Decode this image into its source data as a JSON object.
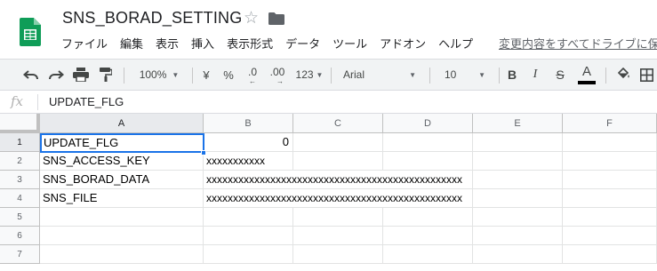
{
  "app": {
    "doc_title": "SNS_BORAD_SETTING",
    "logo_icon": "google-sheets-logo",
    "star_icon": "star-icon",
    "folder_icon": "folder-icon",
    "brand_color": "#0f9d58"
  },
  "menu": {
    "items": [
      "ファイル",
      "編集",
      "表示",
      "挿入",
      "表示形式",
      "データ",
      "ツール",
      "アドオン",
      "ヘルプ"
    ],
    "save_status": "変更内容をすべてドライブに保"
  },
  "toolbar": {
    "undo_icon": "undo-icon",
    "redo_icon": "redo-icon",
    "print_icon": "print-icon",
    "paint_format_icon": "paint-format-icon",
    "zoom": "100%",
    "currency": "¥",
    "percent": "%",
    "decrease_decimal": ".0",
    "increase_decimal": ".00",
    "number_format": "123",
    "font": "Arial",
    "font_size": "10",
    "bold": "B",
    "italic": "I",
    "strikethrough": "S",
    "text_color": "A",
    "fill_icon": "fill-color-icon",
    "borders_icon": "borders-icon"
  },
  "formula_bar": {
    "fx_label": "fx",
    "content": "UPDATE_FLG"
  },
  "sheet": {
    "columns": [
      "A",
      "B",
      "C",
      "D",
      "E",
      "F"
    ],
    "rows": [
      "1",
      "2",
      "3",
      "4",
      "5",
      "6",
      "7"
    ],
    "active_cell": "A1",
    "cells": {
      "A1": "UPDATE_FLG",
      "B1": "0",
      "A2": "SNS_ACCESS_KEY",
      "B2": "xxxxxxxxxxx",
      "A3": "SNS_BORAD_DATA",
      "B3": "xxxxxxxxxxxxxxxxxxxxxxxxxxxxxxxxxxxxxxxxxxxxxxxx",
      "A4": "SNS_FILE",
      "B4": "xxxxxxxxxxxxxxxxxxxxxxxxxxxxxxxxxxxxxxxxxxxxxxxx"
    }
  }
}
